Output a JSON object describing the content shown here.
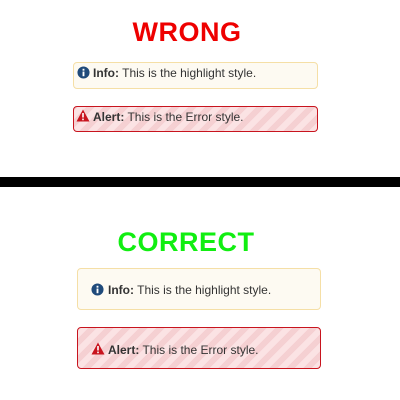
{
  "wrong": {
    "heading": "WRONG",
    "info": {
      "label": "Info:",
      "message": " This is the highlight style."
    },
    "alert": {
      "label": "Alert:",
      "message": " This is the Error style."
    }
  },
  "correct": {
    "heading": "CORRECT",
    "info": {
      "label": "Info:",
      "message": " This is the highlight style."
    },
    "alert": {
      "label": "Alert:",
      "message": " This is the Error style."
    }
  },
  "colors": {
    "wrong_heading": "#ee0000",
    "correct_heading": "#11ee11",
    "info_icon": "#1f4a7a",
    "alert_icon": "#c8141e",
    "highlight_border": "#f5dfa6",
    "error_border": "#c8141e"
  },
  "icons": {
    "info": "info-circle-icon",
    "alert": "warning-triangle-icon"
  }
}
